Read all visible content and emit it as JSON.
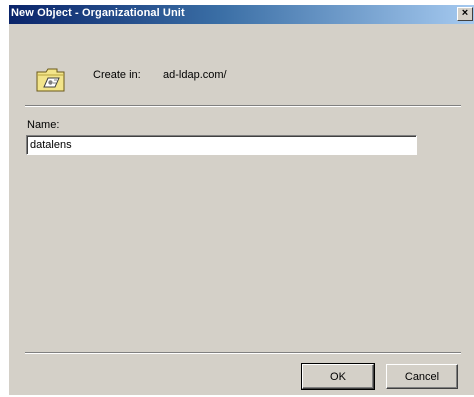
{
  "window": {
    "title": "New Object - Organizational Unit",
    "close_label": "×"
  },
  "header": {
    "icon": "folder-icon",
    "create_label": "Create in:",
    "create_value": "ad-ldap.com/"
  },
  "form": {
    "name_label": "Name:",
    "name_value": "datalens"
  },
  "buttons": {
    "ok_label": "OK",
    "cancel_label": "Cancel"
  }
}
